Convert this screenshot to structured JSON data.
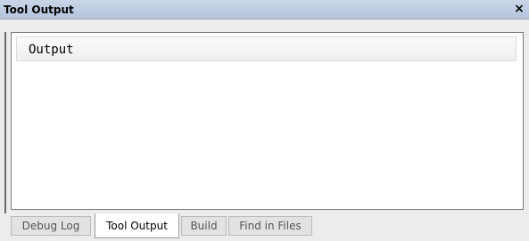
{
  "window": {
    "title": "Tool Output",
    "close_glyph": "×"
  },
  "output": {
    "header": "Output"
  },
  "tabs": [
    {
      "label": "Debug Log",
      "active": false
    },
    {
      "label": "Tool Output",
      "active": true
    },
    {
      "label": "Build",
      "active": false
    },
    {
      "label": "Find in Files",
      "active": false
    }
  ],
  "colors": {
    "titlebar": "#b3c4dc",
    "background": "#ececec",
    "content": "#ffffff"
  }
}
